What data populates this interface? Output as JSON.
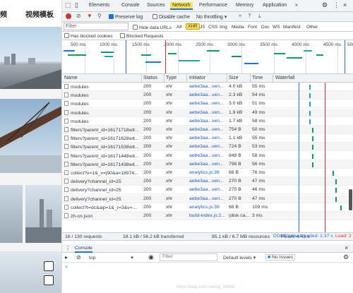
{
  "page": {
    "left_header_partial": "频",
    "left_header_title": "视频模板",
    "watermark": "https://blog.csdn.net/qq_39888..."
  },
  "devtools": {
    "tabs": [
      {
        "label": "Elements",
        "active": false
      },
      {
        "label": "Console",
        "active": false
      },
      {
        "label": "Sources",
        "active": false
      },
      {
        "label": "Network",
        "active": true
      },
      {
        "label": "Performance",
        "active": false
      },
      {
        "label": "Memory",
        "active": false
      },
      {
        "label": "Application",
        "active": false
      }
    ],
    "toolbar": {
      "preserve_log": "Preserve log",
      "disable_cache": "Disable cache",
      "throttling": "No throttling"
    },
    "filter": {
      "placeholder": "Filter",
      "hide_data_urls": "Hide data URLs",
      "types": [
        "All",
        "XHR",
        "JS",
        "CSS",
        "Img",
        "Media",
        "Font",
        "Doc",
        "WS",
        "Manifest",
        "Other"
      ],
      "active_type": "XHR",
      "has_blocked_cookies": "Has blocked cookies",
      "blocked_requests": "Blocked Requests"
    },
    "overview_ticks": [
      "500 ms",
      "1000 ms",
      "1500 ms",
      "2000 ms",
      "2500 ms",
      "3000 ms",
      "3500 ms",
      "4000 ms",
      "4500 ms",
      "500"
    ],
    "columns": [
      "Name",
      "Status",
      "Type",
      "Initiator",
      "Size",
      "Time",
      "Waterfall"
    ],
    "rows": [
      {
        "name": "modules",
        "status": "200",
        "type": "xhr",
        "initiator": "aebe3aa...ven...",
        "size": "4.0 kB",
        "time": "55 ms",
        "wf": 0.45
      },
      {
        "name": "modules",
        "status": "200",
        "type": "xhr",
        "initiator": "aebe3aa...ven...",
        "size": "2.3 kB",
        "time": "54 ms",
        "wf": 0.45
      },
      {
        "name": "modules",
        "status": "200",
        "type": "xhr",
        "initiator": "aebe3aa...ven...",
        "size": "3.0 kB",
        "time": "51 ms",
        "wf": 0.45
      },
      {
        "name": "modules",
        "status": "200",
        "type": "xhr",
        "initiator": "aebe3aa...ven...",
        "size": "1.9 kB",
        "time": "49 ms",
        "wf": 0.45
      },
      {
        "name": "modules",
        "status": "200",
        "type": "xhr",
        "initiator": "aebe3aa...ven...",
        "size": "1.7 kB",
        "time": "58 ms",
        "wf": 0.45
      },
      {
        "name": "filters?parent_id=16171718wit...",
        "status": "200",
        "type": "xhr",
        "initiator": "aebe3aa...ven...",
        "size": "754 B",
        "time": "50 ms",
        "wf": 0.49
      },
      {
        "name": "filters?parent_id=16171628wit...",
        "status": "200",
        "type": "xhr",
        "initiator": "aebe3aa...ven...",
        "size": "1.1 kB",
        "time": "55 ms",
        "wf": 0.49
      },
      {
        "name": "filters?parent_id=16171538wit...",
        "status": "200",
        "type": "xhr",
        "initiator": "aebe3aa...ven...",
        "size": "724 B",
        "time": "53 ms",
        "wf": 0.49
      },
      {
        "name": "filters?parent_id=16171448wit...",
        "status": "200",
        "type": "xhr",
        "initiator": "aebe3aa...ven...",
        "size": "848 B",
        "time": "58 ms",
        "wf": 0.49
      },
      {
        "name": "filters?parent_id=16171438wit...",
        "status": "200",
        "type": "xhr",
        "initiator": "aebe3aa...ven...",
        "size": "798 B",
        "time": "56 ms",
        "wf": 0.49
      },
      {
        "name": "collect?v=1&_v=j90&a=18974...",
        "status": "200",
        "type": "xhr",
        "initiator": "analytics.js:39",
        "size": "68 B",
        "time": "76 ms",
        "wf": 0.76
      },
      {
        "name": "delivery?channel_id=25",
        "status": "200",
        "type": "xhr",
        "initiator": "aebe3aa...ven...",
        "size": "270 B",
        "time": "47 ms",
        "wf": 0.8
      },
      {
        "name": "delivery?channel_id=25",
        "status": "200",
        "type": "xhr",
        "initiator": "aebe3aa...ven...",
        "size": "270 B",
        "time": "46 ms",
        "wf": 0.8
      },
      {
        "name": "delivery?channel_id=25",
        "status": "200",
        "type": "xhr",
        "initiator": "aebe3aa...ven...",
        "size": "270 B",
        "time": "47 ms",
        "wf": 0.8
      },
      {
        "name": "collect?t=dc&aip=1&_r=3&v=...",
        "status": "200",
        "type": "xhr",
        "initiator": "analytics.js:39",
        "size": "68 B",
        "time": "109 ms",
        "wf": 0.87
      },
      {
        "name": "zh-cn.json",
        "status": "200",
        "type": "xhr",
        "initiator": "build-index.js:2...",
        "size": "(disk ca...",
        "time": "3 ms",
        "wf": null
      }
    ],
    "status_bar": {
      "requests": "16 / 130 requests",
      "transferred": "18.1 kB / 56.2 kB transferred",
      "resources": "85.1 kB / 6.7 MB resources",
      "finish": "Finish: 4.45 s",
      "dcl": "DOMContentLoaded: 1.37 s",
      "load": "Load: 2"
    },
    "drawer": {
      "tab": "Console",
      "context": "top",
      "filter_placeholder": "Filter",
      "levels": "Default levels",
      "issues": "No Issues",
      "prompt": ">"
    },
    "colors": {
      "accent": "#1a73e8",
      "highlight": "#ffe34c",
      "record": "#d93025",
      "dcl_line": "#1a73e8",
      "load_line": "#d93025"
    }
  }
}
